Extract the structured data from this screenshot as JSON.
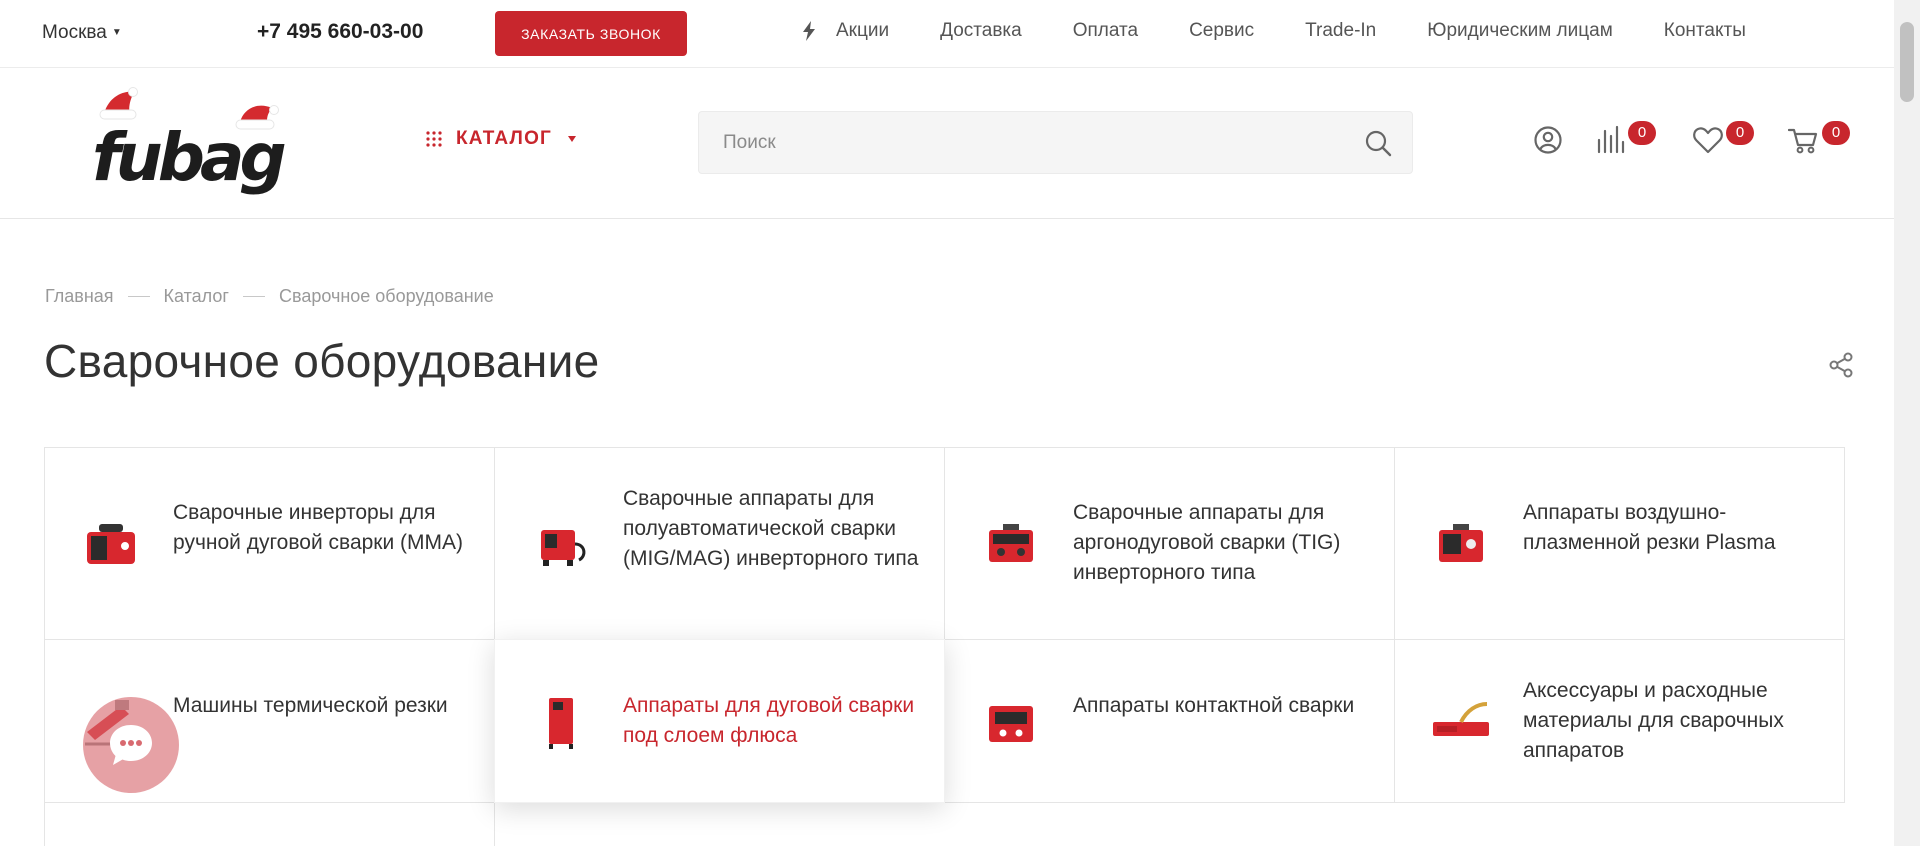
{
  "topbar": {
    "city": "Москва",
    "phone": "+7 495 660-03-00",
    "callback_label": "Заказать звонок",
    "nav": [
      "Акции",
      "Доставка",
      "Оплата",
      "Сервис",
      "Trade-In",
      "Юридическим лицам",
      "Контакты"
    ]
  },
  "header": {
    "logo_text": "fubag",
    "catalog_label": "КАТАЛОГ",
    "search_placeholder": "Поиск",
    "compare_count": "0",
    "favorites_count": "0",
    "cart_count": "0"
  },
  "breadcrumb": [
    "Главная",
    "Каталог",
    "Сварочное оборудование"
  ],
  "page_title": "Сварочное оборудование",
  "categories": [
    {
      "title": "Сварочные инверторы для ручной дуговой сварки (MMA)",
      "icon": "mma-inverter-icon"
    },
    {
      "title": "Сварочные аппараты для полуавтоматической сварки (MIG/MAG) инверторного типа",
      "icon": "mig-mag-welder-icon"
    },
    {
      "title": "Сварочные аппараты для аргонодуговой сварки (TIG) инверторного типа",
      "icon": "tig-welder-icon"
    },
    {
      "title": "Аппараты воздушно-плазменной резки Plasma",
      "icon": "plasma-cutter-icon"
    },
    {
      "title": "Машины термической резки",
      "icon": "thermal-cutting-machine-icon"
    },
    {
      "title": "Аппараты для дуговой сварки под слоем флюса",
      "icon": "submerged-arc-welder-icon"
    },
    {
      "title": "Аппараты контактной сварки",
      "icon": "spot-welder-icon"
    },
    {
      "title": "Аксессуары и расходные материалы для сварочных аппаратов",
      "icon": "welding-torch-icon"
    }
  ],
  "colors": {
    "accent": "#c8262d",
    "text": "#333333",
    "muted": "#999999",
    "border": "#e5e5e5"
  }
}
